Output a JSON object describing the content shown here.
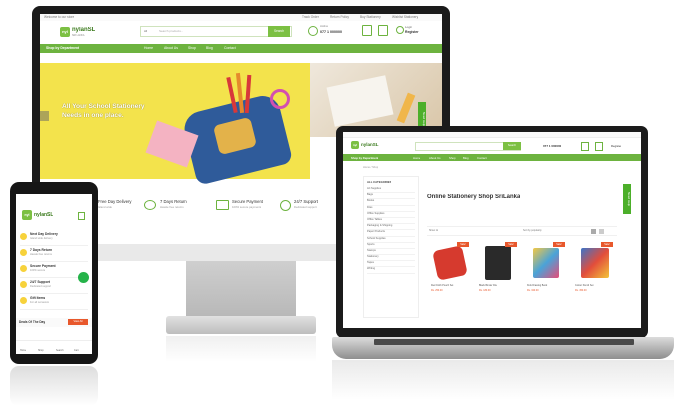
{
  "brand": {
    "logo_letters": "nyl",
    "logo_name": "nylanSL",
    "logo_tagline": "SRI LANKA",
    "accent": "#7cc043",
    "nav_green": "#6db33f",
    "hero_yellow": "#f3e34c",
    "sale_orange": "#e8582c"
  },
  "desktop": {
    "topbar_left": "Welcome to our store",
    "topbar_links": [
      "Track Order",
      "Return Policy",
      "Buy Stationery",
      "Wishlist Stationery"
    ],
    "search_category": "All",
    "search_placeholder": "Search products...",
    "search_button": "Search",
    "hotline_label": "Hotline",
    "hotline_number": "077 1 000000",
    "account_label": "Login",
    "account_sub": "Register",
    "shop_by_department": "Shop by Department",
    "nav_items": [
      "Home",
      "About Us",
      "Shop",
      "Blog",
      "Contact"
    ],
    "hero_line1": "All Your School Stationery",
    "hero_line2": "Needs in one place.",
    "side_tab": "Need Help",
    "features": [
      {
        "title": "Free Day Delivery",
        "sub": "Island wide"
      },
      {
        "title": "7 Days Return",
        "sub": "Hassle free returns"
      },
      {
        "title": "Secure Payment",
        "sub": "100% secure payments"
      },
      {
        "title": "24/7 Support",
        "sub": "Dedicated support"
      }
    ]
  },
  "laptop": {
    "breadcrumb": "Home / Shop",
    "categories_title": "ALL CATEGORIES",
    "categories": [
      "Art Supplies",
      "Bags",
      "Books",
      "Files",
      "Office Supplies",
      "Office Tables",
      "Packaging & Shipping",
      "Paper Products",
      "School Supplies",
      "Sports",
      "Stamps",
      "Stationery",
      "Tapes",
      "Writing"
    ],
    "page_title": "Online Stationery Shop SriLanka",
    "sort_label": "Sort by popularity",
    "show_label": "Show 12",
    "side_tab": "Need Help",
    "sale_label": "Sale!",
    "products": [
      {
        "name": "Red Cloth Pouch Set",
        "price": "Rs. 250.00"
      },
      {
        "name": "Black Binder File",
        "price": "Rs. 180.00"
      },
      {
        "name": "Kids Drawing Book",
        "price": "Rs. 320.00"
      },
      {
        "name": "Colour Pencil Set",
        "price": "Rs. 450.00"
      }
    ]
  },
  "phone": {
    "logo_name": "nylanSL",
    "rows": [
      {
        "title": "Next Day Delivery",
        "sub": "Island wide delivery"
      },
      {
        "title": "7 Days Return",
        "sub": "Hassle free returns"
      },
      {
        "title": "Secure Payment",
        "sub": "100% secure"
      },
      {
        "title": "24/7 Support",
        "sub": "Dedicated support"
      },
      {
        "title": "Gift Items",
        "sub": "For all occasions"
      }
    ],
    "deal_label": "Deals Of The Day",
    "deal_button": "View All",
    "bottom_nav": [
      "Home",
      "Shop",
      "Search",
      "Cart"
    ]
  }
}
